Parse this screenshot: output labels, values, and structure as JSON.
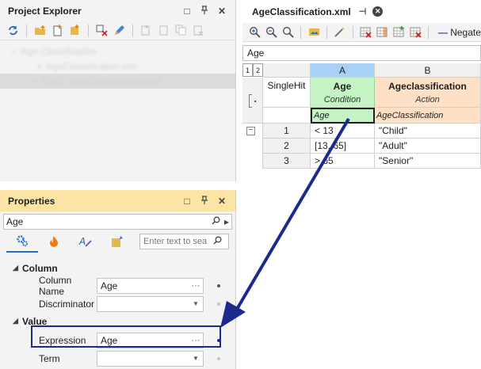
{
  "project_explorer": {
    "title": "Project Explorer",
    "header_buttons": [
      "□",
      "⊼",
      "✕"
    ],
    "tree": [
      {
        "label": "Age Classification"
      },
      {
        "label": "AgeClassification.xml"
      },
      {
        "label": "DRG - AgeClassification.xml"
      }
    ]
  },
  "properties": {
    "title": "Properties",
    "header_buttons": [
      "□",
      "⊼",
      "✕"
    ],
    "selected_object": "Age",
    "search_placeholder": "Enter text to sea",
    "categories": [
      {
        "name": "Column",
        "rows": [
          {
            "name": "Column Name",
            "value": "Age"
          },
          {
            "name": "Discriminator",
            "value": ""
          }
        ]
      },
      {
        "name": "Value",
        "rows": [
          {
            "name": "Expression",
            "value": "Age"
          },
          {
            "name": "Term",
            "value": ""
          }
        ]
      }
    ]
  },
  "document_tab": {
    "title": "AgeClassification.xml"
  },
  "editor_toolbar": {
    "negate_label": "Negate"
  },
  "cell_editor": {
    "value": "Age"
  },
  "grid": {
    "outline_levels": [
      "1",
      "2"
    ],
    "hit_policy": "SingleHit",
    "columns": [
      {
        "letter": "A",
        "name": "Age",
        "kind": "Condition",
        "term": "Age"
      },
      {
        "letter": "B",
        "name": "Ageclassification",
        "kind": "Action",
        "term": "AgeClassification"
      }
    ],
    "rows": [
      {
        "num": "1",
        "cond": "< 13",
        "action": "\"Child\""
      },
      {
        "num": "2",
        "cond": "[13..65]",
        "action": "\"Adult\""
      },
      {
        "num": "3",
        "cond": "> 65",
        "action": "\"Senior\""
      }
    ]
  },
  "colors": {
    "condition_bg": "#c6f3c4",
    "action_bg": "#fde0c6",
    "properties_header": "#fce4a4",
    "annotation_arrow": "#1c2a8c"
  }
}
